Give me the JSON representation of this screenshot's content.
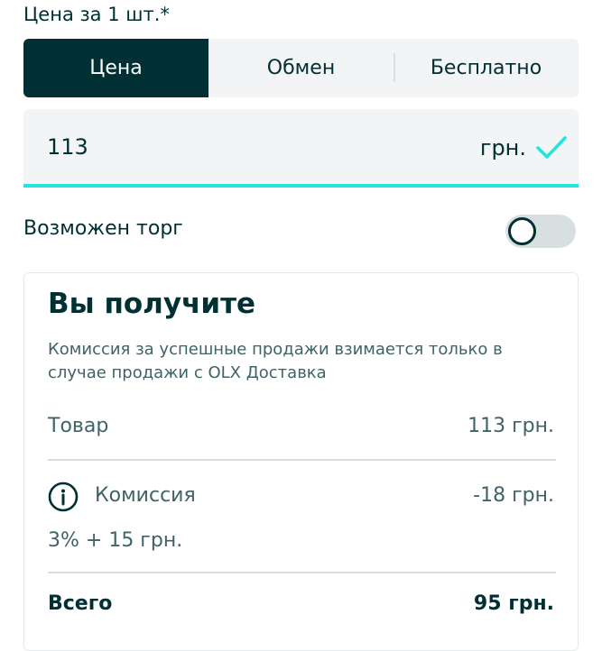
{
  "price_label": "Цена за 1 шт.*",
  "segments": [
    {
      "label": "Цена",
      "active": true
    },
    {
      "label": "Обмен",
      "active": false
    },
    {
      "label": "Бесплатно",
      "active": false
    }
  ],
  "price_field": {
    "value": "113",
    "currency": "грн."
  },
  "haggle": {
    "label": "Возможен торг",
    "enabled": false
  },
  "summary": {
    "title": "Вы получите",
    "note": "Комиссия за успешные продажи взимается только в случае продажи с OLX Доставка",
    "item_label": "Товар",
    "item_value": "113 грн.",
    "commission_label": "Комиссия",
    "commission_value": "-18 грн.",
    "commission_formula": "3% + 15 грн.",
    "total_label": "Всего",
    "total_value": "95 грн."
  },
  "colors": {
    "accent": "#23e5db",
    "primary": "#002f34",
    "field_bg": "#f2f4f5"
  }
}
